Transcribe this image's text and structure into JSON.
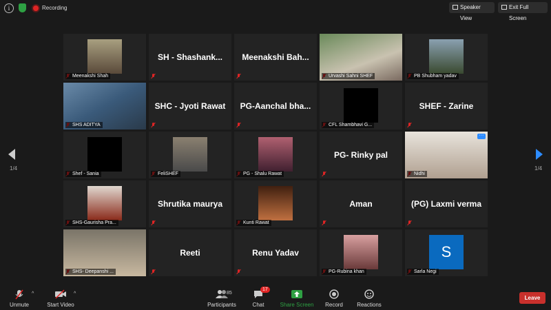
{
  "top_bar": {
    "recording_label": "Recording",
    "speaker_view_label": "Speaker View",
    "exit_full_screen_label": "Exit Full Screen"
  },
  "colors": {
    "accent": "#2d8cff",
    "active_speaker_border": "#c6e04a",
    "leave": "#c9302c",
    "share_green": "#2ea043",
    "mute_red": "#e02424"
  },
  "tiles": [
    {
      "kind": "video",
      "label": "Meenakshi Shah"
    },
    {
      "kind": "name",
      "name": "SH  - Shashank...",
      "label": ""
    },
    {
      "kind": "name",
      "name": "Meenakshi  Bah...",
      "label": ""
    },
    {
      "kind": "video",
      "label": "Urvashi Sahni SHEF"
    },
    {
      "kind": "video",
      "label": "PB Shubham yadav"
    },
    {
      "kind": "video",
      "label": "SHS ADITYA",
      "active": true
    },
    {
      "kind": "name",
      "name": "SHC - Jyoti Rawat",
      "label": ""
    },
    {
      "kind": "name",
      "name": "PG-Aanchal  bha...",
      "label": ""
    },
    {
      "kind": "video",
      "label": "CFL Shambhavi G..."
    },
    {
      "kind": "name",
      "name": "SHEF - Zarine",
      "label": ""
    },
    {
      "kind": "video",
      "label": "Shef - Sania"
    },
    {
      "kind": "video",
      "label": "FeliSHEF"
    },
    {
      "kind": "video",
      "label": "PG - Shalu Rawat"
    },
    {
      "kind": "name",
      "name": "PG- Rinky pal",
      "label": ""
    },
    {
      "kind": "video",
      "label": "Nidhi"
    },
    {
      "kind": "video",
      "label": "SHS-Gaurisha Pra..."
    },
    {
      "kind": "name",
      "name": "Shrutika maurya",
      "label": ""
    },
    {
      "kind": "video",
      "label": "Kunti Rawat"
    },
    {
      "kind": "name",
      "name": "Aman",
      "label": ""
    },
    {
      "kind": "name",
      "name": "(PG) Laxmi verma",
      "label": ""
    },
    {
      "kind": "video",
      "label": "SHS- Deepanshi ..."
    },
    {
      "kind": "name",
      "name": "Reeti",
      "label": ""
    },
    {
      "kind": "name",
      "name": "Renu Yadav",
      "label": ""
    },
    {
      "kind": "video",
      "label": "PG-Rubina khan"
    },
    {
      "kind": "avatar",
      "avatar_letter": "S",
      "label": "Sarla Negi"
    }
  ],
  "pager": {
    "left": "1/4",
    "right": "1/4"
  },
  "toolbar": {
    "unmute_label": "Unmute",
    "start_video_label": "Start Video",
    "participants_label": "Participants",
    "participants_count": "85",
    "chat_label": "Chat",
    "chat_badge": "17",
    "share_screen_label": "Share Screen",
    "record_label": "Record",
    "reactions_label": "Reactions",
    "leave_label": "Leave"
  }
}
